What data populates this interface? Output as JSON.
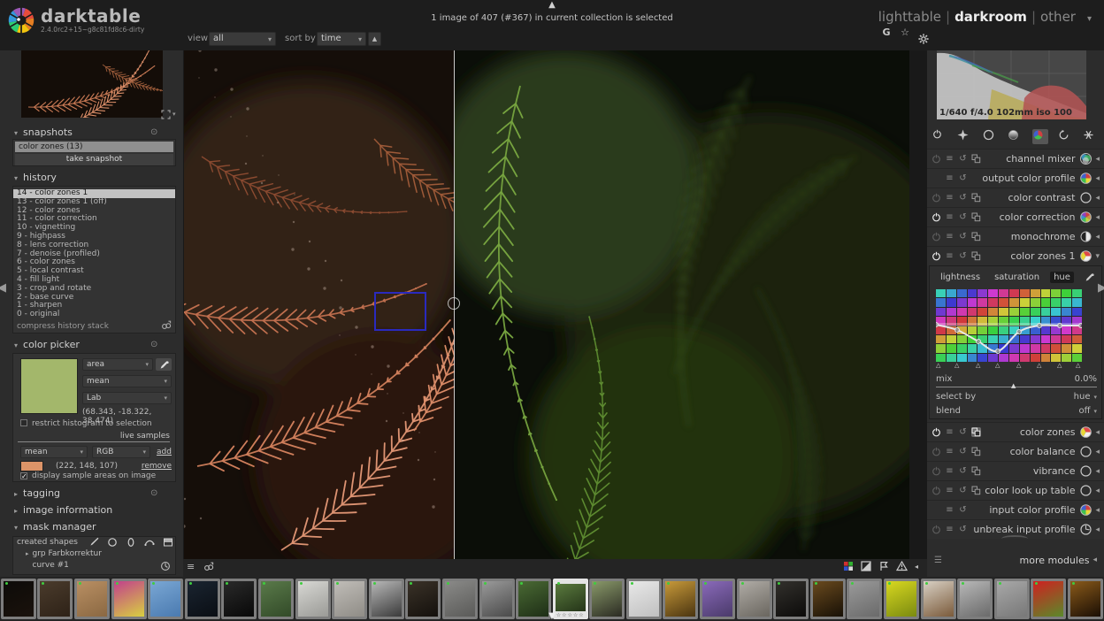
{
  "app": {
    "name": "darktable",
    "version": "2.4.0rc2+15~g8c81fd8c6-dirty"
  },
  "top": {
    "status": "1 image of 407 (#367) in current collection is selected",
    "views": [
      {
        "label": "lighttable",
        "active": false
      },
      {
        "label": "darkroom",
        "active": true
      },
      {
        "label": "other",
        "active": false
      }
    ]
  },
  "center_toolbar": {
    "view_label": "view",
    "view_value": "all",
    "sort_label": "sort by",
    "sort_value": "time",
    "right_icons": [
      {
        "name": "guides-overlay-icon",
        "glyph": "G"
      },
      {
        "name": "star-icon",
        "glyph": "☆"
      },
      {
        "name": "gear-icon",
        "glyph": "gear"
      }
    ]
  },
  "left_panel": {
    "snapshots": {
      "title": "snapshots",
      "items": [
        "color zones (13)"
      ],
      "button_label": "take snapshot"
    },
    "history": {
      "title": "history",
      "selected_index": 0,
      "items": [
        "14 - color zones 1",
        "13 - color zones 1 (off)",
        "12 - color zones",
        "11 - color correction",
        "10 - vignetting",
        "9 - highpass",
        "8 - lens correction",
        "7 - denoise (profiled)",
        "6 - color zones",
        "5 - local contrast",
        "4 - fill light",
        "3 - crop and rotate",
        "2 - base curve",
        "1 - sharpen",
        "0 - original"
      ],
      "compress_label": "compress history stack"
    },
    "color_picker": {
      "title": "color picker",
      "swatch_color": "#a3b76b",
      "mode_value": "area",
      "statistic_value": "mean",
      "space_value": "Lab",
      "reading": "(68.343, -18.322, 38.474)",
      "restrict_label": "restrict histogram to selection",
      "restrict_checked": false,
      "live_samples_label": "live samples",
      "sample_statistic": "mean",
      "sample_space": "RGB",
      "add_label": "add",
      "sample_color": "#dc9468",
      "sample_reading": "(222, 148, 107)",
      "remove_label": "remove",
      "display_label": "display sample areas on image",
      "display_checked": true
    },
    "tagging_title": "tagging",
    "image_info_title": "image information",
    "mask_manager": {
      "title": "mask manager",
      "toolbar_label": "created shapes",
      "toolbar_icons": [
        "brush-icon",
        "circle-icon",
        "ellipse-icon",
        "path-icon",
        "gradient-icon"
      ],
      "items": [
        {
          "label": "grp Farbkorrektur",
          "expandable": true,
          "icon": ""
        },
        {
          "label": "curve #1",
          "expandable": false,
          "icon": "clock-icon"
        }
      ]
    }
  },
  "right_panel": {
    "histogram": {
      "exif": "1/640 f/4.0 102mm iso 100"
    },
    "module_groups": [
      "active-modules-icon",
      "favorites-icon",
      "basic-group-icon",
      "tone-group-icon",
      "color-group-icon",
      "correction-group-icon",
      "effects-group-icon"
    ],
    "active_group_index": 4,
    "modules_top": [
      {
        "name": "channel mixer",
        "left_icons": [
          "power-dim",
          "instances",
          "reset",
          "presets"
        ],
        "icon": "channel-mixer",
        "expanded": false
      },
      {
        "name": "output color profile",
        "left_icons": [
          "spacer",
          "instances",
          "reset"
        ],
        "icon": "profile",
        "expanded": false
      },
      {
        "name": "color contrast",
        "left_icons": [
          "power-dim",
          "instances",
          "reset",
          "presets"
        ],
        "icon": "outline",
        "expanded": false
      },
      {
        "name": "color correction",
        "left_icons": [
          "power-on",
          "instances",
          "reset",
          "presets"
        ],
        "icon": "rainbow",
        "expanded": false
      },
      {
        "name": "monochrome",
        "left_icons": [
          "power-dim",
          "instances",
          "reset",
          "presets"
        ],
        "icon": "half",
        "expanded": false
      },
      {
        "name": "color zones 1",
        "left_icons": [
          "power-on",
          "instances",
          "reset",
          "presets"
        ],
        "icon": "pie",
        "expanded": true
      }
    ],
    "color_zones": {
      "tabs": [
        "lightness",
        "saturation",
        "hue"
      ],
      "active_tab": "hue",
      "mix_label": "mix",
      "mix_value": "0.0%",
      "select_by_label": "select by",
      "select_by_value": "hue",
      "blend_label": "blend",
      "blend_value": "off"
    },
    "modules_bottom": [
      {
        "name": "color zones",
        "left_icons": [
          "power-on",
          "instances",
          "reset",
          "presets-active"
        ],
        "icon": "pie",
        "expanded": false
      },
      {
        "name": "color balance",
        "left_icons": [
          "power-dim",
          "instances",
          "reset",
          "presets"
        ],
        "icon": "outline",
        "expanded": false
      },
      {
        "name": "vibrance",
        "left_icons": [
          "power-dim",
          "instances",
          "reset",
          "presets"
        ],
        "icon": "outline",
        "expanded": false
      },
      {
        "name": "color look up table",
        "left_icons": [
          "power-dim",
          "instances",
          "reset",
          "presets"
        ],
        "icon": "outline",
        "expanded": false
      },
      {
        "name": "input color profile",
        "left_icons": [
          "spacer",
          "instances",
          "reset"
        ],
        "icon": "profile",
        "expanded": false
      },
      {
        "name": "unbreak input profile",
        "left_icons": [
          "power-dim",
          "instances",
          "reset"
        ],
        "icon": "clock",
        "expanded": false
      }
    ],
    "more_modules_label": "more modules"
  },
  "viewport": {
    "sample_rect_color": "#2a2abf",
    "bottom_left_icons": [
      "hamburger-icon",
      "duplicates-icon"
    ],
    "bottom_right_icons": [
      "gamut-check-icon",
      "overexposure-icon",
      "softproof-icon",
      "raw-overexposure-icon"
    ]
  },
  "filmstrip": {
    "altered_dot_color": "#3fcc3f",
    "thumbs": [
      {
        "colors": [
          "#0d0b09",
          "#1a120c"
        ],
        "selected": false
      },
      {
        "colors": [
          "#4a3b2c",
          "#2e2217"
        ],
        "selected": false
      },
      {
        "colors": [
          "#b98f63",
          "#8a6842"
        ],
        "selected": false
      },
      {
        "colors": [
          "#c2408c",
          "#d8d040"
        ],
        "selected": false
      },
      {
        "colors": [
          "#7aa7d4",
          "#4a7ab0"
        ],
        "selected": false
      },
      {
        "colors": [
          "#1a2430",
          "#0a0e14"
        ],
        "selected": false
      },
      {
        "colors": [
          "#2a2a2a",
          "#080808"
        ],
        "selected": false
      },
      {
        "colors": [
          "#5a7a4a",
          "#324a28"
        ],
        "selected": false
      },
      {
        "colors": [
          "#d8d8d4",
          "#9a9a96"
        ],
        "selected": false
      },
      {
        "colors": [
          "#c0bdb8",
          "#8f8c86"
        ],
        "selected": false
      },
      {
        "colors": [
          "#b8b8b8",
          "#3a3a3a"
        ],
        "selected": false
      },
      {
        "colors": [
          "#3a3228",
          "#14100c"
        ],
        "selected": false
      },
      {
        "colors": [
          "#8a8a88",
          "#5a5a58"
        ],
        "selected": false
      },
      {
        "colors": [
          "#9a9a9a",
          "#4a4a4a"
        ],
        "selected": false
      },
      {
        "colors": [
          "#4a6a34",
          "#1e2e16"
        ],
        "selected": false
      },
      {
        "colors": [
          "#5a7a3e",
          "#243418"
        ],
        "selected": true
      },
      {
        "colors": [
          "#8a9a6a",
          "#2a2a22"
        ],
        "selected": false
      },
      {
        "colors": [
          "#e8e8e8",
          "#c0c0c0"
        ],
        "selected": false
      },
      {
        "colors": [
          "#c89a3a",
          "#4a3410"
        ],
        "selected": false
      },
      {
        "colors": [
          "#8a6aba",
          "#4a3a6a"
        ],
        "selected": false
      },
      {
        "colors": [
          "#b0aca6",
          "#6a665f"
        ],
        "selected": false
      },
      {
        "colors": [
          "#32302c",
          "#0c0b0a"
        ],
        "selected": false
      },
      {
        "colors": [
          "#6a4a1e",
          "#171006"
        ],
        "selected": false
      },
      {
        "colors": [
          "#9a9a9a",
          "#6a6a6a"
        ],
        "selected": false
      },
      {
        "colors": [
          "#d8d820",
          "#7a8a10"
        ],
        "selected": false
      },
      {
        "colors": [
          "#d8d0c4",
          "#7a5a3a"
        ],
        "selected": false
      },
      {
        "colors": [
          "#b8b8b8",
          "#6a6a6a"
        ],
        "selected": false
      },
      {
        "colors": [
          "#a8a8a8",
          "#787878"
        ],
        "selected": false
      },
      {
        "colors": [
          "#d02020",
          "#5a8a2a"
        ],
        "selected": false
      },
      {
        "colors": [
          "#8a5a1a",
          "#1a0e04"
        ],
        "selected": false
      }
    ]
  }
}
